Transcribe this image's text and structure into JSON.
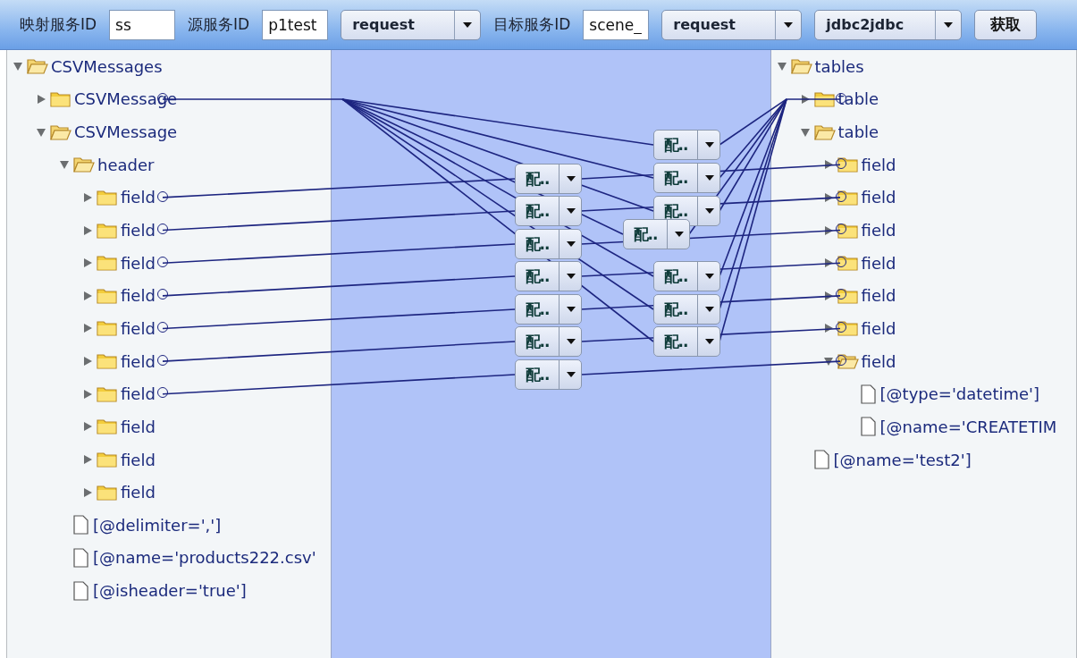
{
  "toolbar": {
    "items": [
      {
        "kind": "label",
        "text": "映射服务ID"
      },
      {
        "kind": "input",
        "value": "ss"
      },
      {
        "kind": "label",
        "text": "源服务ID"
      },
      {
        "kind": "input",
        "value": "p1test"
      },
      {
        "kind": "select",
        "value": "request"
      },
      {
        "kind": "label",
        "text": "目标服务ID"
      },
      {
        "kind": "input",
        "value": "scene_"
      },
      {
        "kind": "select",
        "value": "request"
      },
      {
        "kind": "select",
        "value": "jdbc2jdbc"
      },
      {
        "kind": "button",
        "text": "获取"
      }
    ]
  },
  "source_tree": [
    {
      "label": "CSVMessages",
      "kind": "folder",
      "expanded": true,
      "mapped": false,
      "children": [
        {
          "label": "CSVMessage",
          "kind": "folder",
          "expanded": false,
          "mapped": true
        },
        {
          "label": "CSVMessage",
          "kind": "folder",
          "expanded": true,
          "mapped": false,
          "children": [
            {
              "label": "header",
              "kind": "folder",
              "expanded": true,
              "mapped": false,
              "children": [
                {
                  "label": "field",
                  "kind": "folder",
                  "expanded": false,
                  "mapped": true
                },
                {
                  "label": "field",
                  "kind": "folder",
                  "expanded": false,
                  "mapped": true
                },
                {
                  "label": "field",
                  "kind": "folder",
                  "expanded": false,
                  "mapped": true
                },
                {
                  "label": "field",
                  "kind": "folder",
                  "expanded": false,
                  "mapped": true
                },
                {
                  "label": "field",
                  "kind": "folder",
                  "expanded": false,
                  "mapped": true
                },
                {
                  "label": "field",
                  "kind": "folder",
                  "expanded": false,
                  "mapped": true
                },
                {
                  "label": "field",
                  "kind": "folder",
                  "expanded": false,
                  "mapped": true
                },
                {
                  "label": "field",
                  "kind": "folder",
                  "expanded": false,
                  "mapped": false
                },
                {
                  "label": "field",
                  "kind": "folder",
                  "expanded": false,
                  "mapped": false
                },
                {
                  "label": "field",
                  "kind": "folder",
                  "expanded": false,
                  "mapped": false
                }
              ]
            },
            {
              "label": "[@delimiter=',']",
              "kind": "file",
              "mapped": false
            },
            {
              "label": "[@name='products222.csv'",
              "kind": "file",
              "mapped": false
            },
            {
              "label": "[@isheader='true']",
              "kind": "file",
              "mapped": false
            }
          ]
        }
      ]
    }
  ],
  "mapping_functions": [
    {
      "label": "配.."
    },
    {
      "label": "配.."
    },
    {
      "label": "配.."
    },
    {
      "label": "配.."
    },
    {
      "label": "配.."
    },
    {
      "label": "配.."
    },
    {
      "label": "配.."
    },
    {
      "label": "配.."
    },
    {
      "label": "配.."
    },
    {
      "label": "配.."
    },
    {
      "label": "配.."
    },
    {
      "label": "配.."
    },
    {
      "label": "配.."
    },
    {
      "label": "配.."
    }
  ],
  "target_tree": [
    {
      "label": "tables",
      "kind": "folder",
      "expanded": true,
      "mapped": false,
      "children": [
        {
          "label": "table",
          "kind": "folder",
          "expanded": false,
          "mapped": true
        },
        {
          "label": "table",
          "kind": "folder",
          "expanded": true,
          "mapped": false,
          "children": [
            {
              "label": "field",
              "kind": "folder",
              "expanded": false,
              "mapped": true
            },
            {
              "label": "field",
              "kind": "folder",
              "expanded": false,
              "mapped": true
            },
            {
              "label": "field",
              "kind": "folder",
              "expanded": false,
              "mapped": true
            },
            {
              "label": "field",
              "kind": "folder",
              "expanded": false,
              "mapped": true
            },
            {
              "label": "field",
              "kind": "folder",
              "expanded": false,
              "mapped": true
            },
            {
              "label": "field",
              "kind": "folder",
              "expanded": false,
              "mapped": true
            },
            {
              "label": "field",
              "kind": "folder",
              "expanded": true,
              "mapped": true,
              "children": [
                {
                  "label": "[@type='datetime']",
                  "kind": "file",
                  "mapped": false
                },
                {
                  "label": "[@name='CREATETIM",
                  "kind": "file",
                  "mapped": false
                }
              ]
            }
          ]
        },
        {
          "label": "[@name='test2']",
          "kind": "file",
          "mapped": false
        }
      ]
    }
  ]
}
